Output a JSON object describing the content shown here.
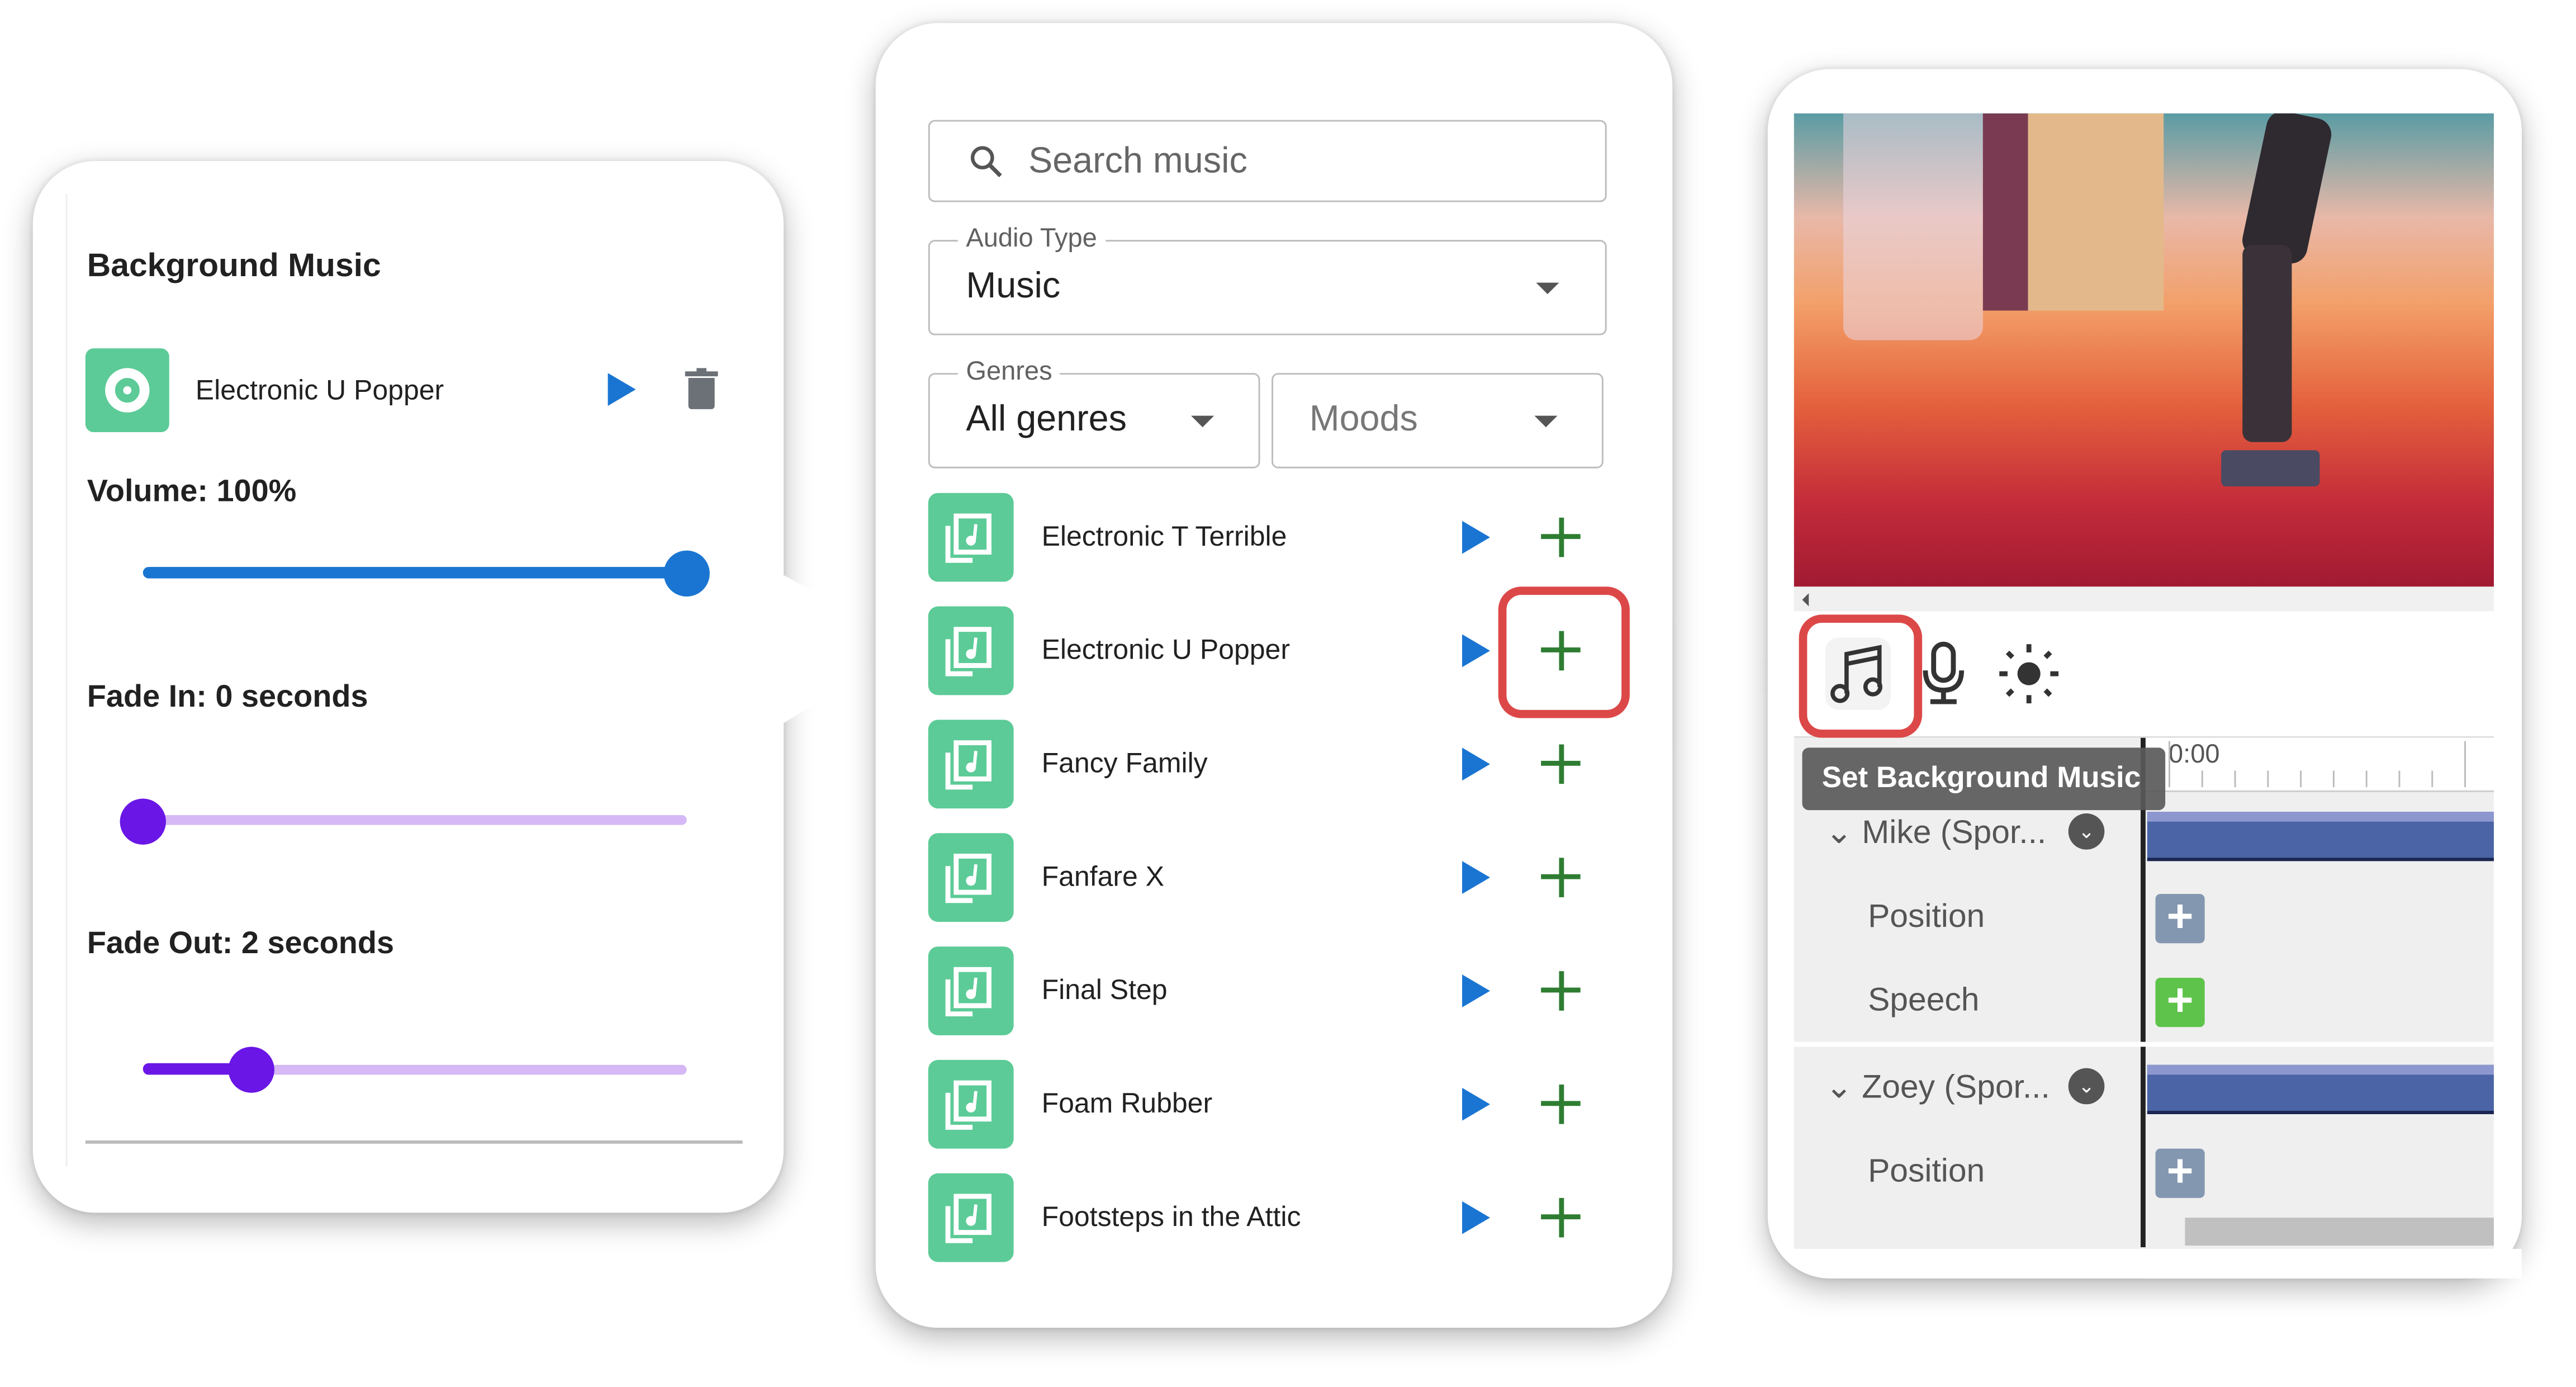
{
  "background_music_panel": {
    "title": "Background Music",
    "track_name": "Electronic U Popper",
    "volume_label": "Volume: 100%",
    "volume_value": 100,
    "fade_in_label": "Fade In: 0 seconds",
    "fade_in_value": 0,
    "fade_out_label": "Fade Out: 2 seconds",
    "fade_out_value": 2,
    "icons": [
      "disc-icon",
      "play-icon",
      "trash-icon"
    ]
  },
  "music_library": {
    "search_placeholder": "Search music",
    "audio_type_label": "Audio Type",
    "audio_type_value": "Music",
    "genres_label": "Genres",
    "genres_value": "All genres",
    "moods_placeholder": "Moods",
    "tracks": [
      {
        "name": "Electronic T Terrible"
      },
      {
        "name": "Electronic U Popper",
        "highlighted": true
      },
      {
        "name": "Fancy Family"
      },
      {
        "name": "Fanfare X"
      },
      {
        "name": "Final Step"
      },
      {
        "name": "Foam Rubber"
      },
      {
        "name": "Footsteps in the Attic"
      }
    ]
  },
  "editor": {
    "toolbar_icons": [
      "music-note-icon",
      "microphone-icon",
      "brightness-icon"
    ],
    "tooltip": "Set Background Music",
    "timecode": "0:00",
    "tracks": [
      {
        "name": "Mike (Spor...",
        "rows": [
          "Position",
          "Speech"
        ]
      },
      {
        "name": "Zoey (Spor...",
        "rows": [
          "Position"
        ]
      }
    ]
  },
  "colors": {
    "accent_blue": "#1a75d2",
    "track_green": "#5ccb97",
    "fade_purple": "#6a16e6",
    "highlight_red": "#dc4848",
    "add_green": "#2e7d32"
  }
}
